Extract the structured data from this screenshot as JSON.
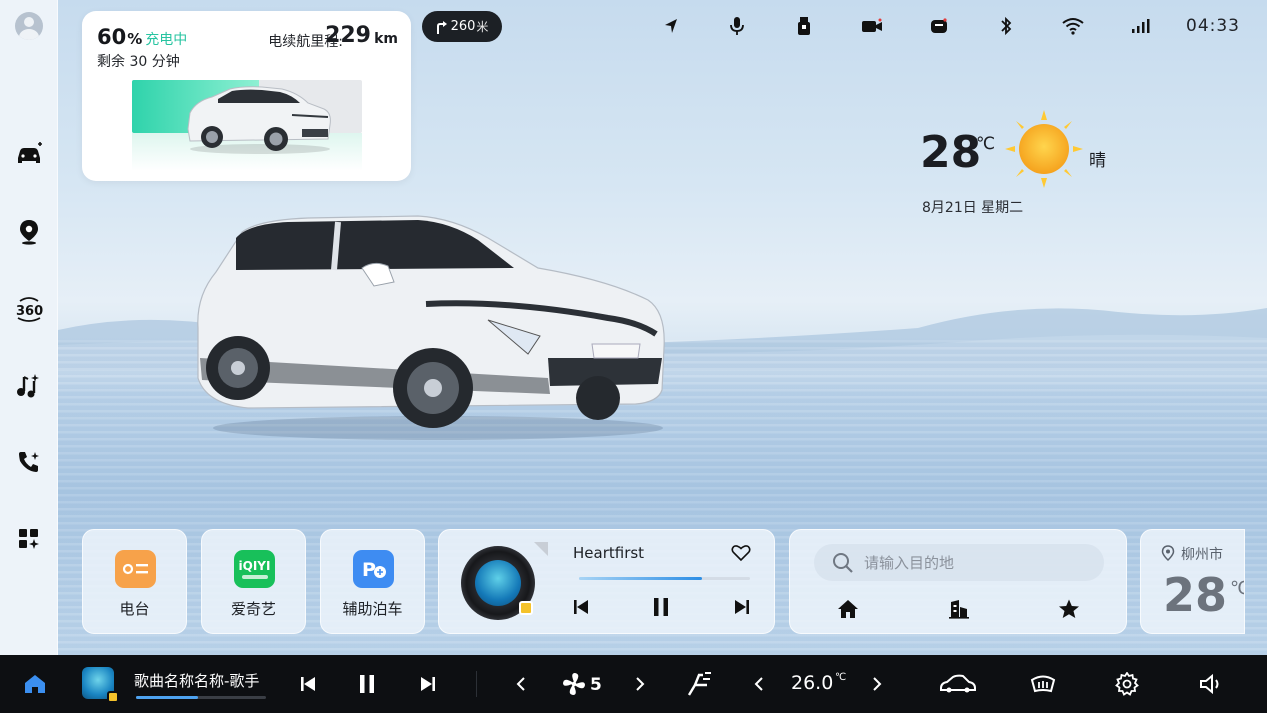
{
  "battery": {
    "percent": "60",
    "percent_unit": "%",
    "status": "充电中",
    "remaining": "剩余 30 分钟",
    "range_label": "电续航里程:",
    "range_value": "229",
    "range_unit": "km",
    "level_fraction": 0.55
  },
  "navigation_hint": {
    "distance": "260",
    "unit": "米",
    "icon": "turn-right-icon"
  },
  "status_bar": {
    "icons": [
      "navigation-arrow-icon",
      "microphone-icon",
      "usb-icon",
      "camera-icon",
      "phone-device-icon",
      "bluetooth-icon",
      "wifi-icon",
      "signal-icon"
    ],
    "time": "04:33"
  },
  "weather": {
    "temperature": "28",
    "unit": "℃",
    "condition": "晴",
    "date": "8月21日  星期二"
  },
  "sidebar": {
    "items": [
      "avatar",
      "car-icon",
      "map-pin-icon",
      "360-camera-icon",
      "music-icon",
      "phone-call-icon",
      "apps-icon"
    ]
  },
  "apps": [
    {
      "label": "电台",
      "icon": "radio-icon",
      "color": "#f7a24a"
    },
    {
      "label": "爱奇艺",
      "icon": "iqiyi-icon",
      "color": "#18c05a",
      "logo_text": "iQIYI"
    },
    {
      "label": "辅助泊车",
      "icon": "parking-icon",
      "color": "#3e8cf2"
    }
  ],
  "music": {
    "title": "Heartfirst",
    "progress": 0.72
  },
  "nav_card": {
    "search_placeholder": "请输入目的地",
    "buttons": [
      "home-icon",
      "company-icon",
      "favorite-icon"
    ]
  },
  "city_weather": {
    "city": "柳州市",
    "temperature": "28",
    "unit": "℃"
  },
  "dock": {
    "track": "歌曲名称名称-歌手",
    "track_progress": 0.48,
    "fan_level": "5",
    "ac_temperature": "26.0",
    "ac_unit": "℃"
  },
  "colors": {
    "accent": "#2d8ee5",
    "charging": "#27c4a1",
    "dock_bg": "#0d0f12"
  }
}
